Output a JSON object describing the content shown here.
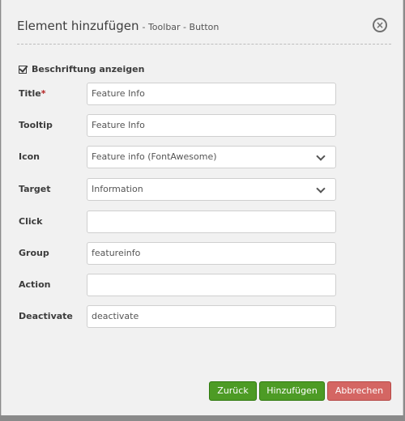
{
  "dialog": {
    "title": "Element hinzufügen",
    "subtitle": "- Toolbar - Button"
  },
  "checkbox": {
    "label": "Beschriftung anzeigen",
    "checked": true
  },
  "fields": [
    {
      "label": "Title",
      "required_marker": "*",
      "value": "Feature Info"
    },
    {
      "label": "Tooltip",
      "value": "Feature Info"
    },
    {
      "label": "Icon",
      "value": "Feature info (FontAwesome)"
    },
    {
      "label": "Target",
      "value": "Information"
    },
    {
      "label": "Click",
      "value": ""
    },
    {
      "label": "Group",
      "value": "featureinfo"
    },
    {
      "label": "Action",
      "value": ""
    },
    {
      "label": "Deactivate",
      "value": "deactivate"
    }
  ],
  "buttons": {
    "back": "Zurück",
    "add": "Hinzufügen",
    "cancel": "Abbrechen"
  },
  "colors": {
    "green": "#4d9b25",
    "red": "#d46663"
  }
}
